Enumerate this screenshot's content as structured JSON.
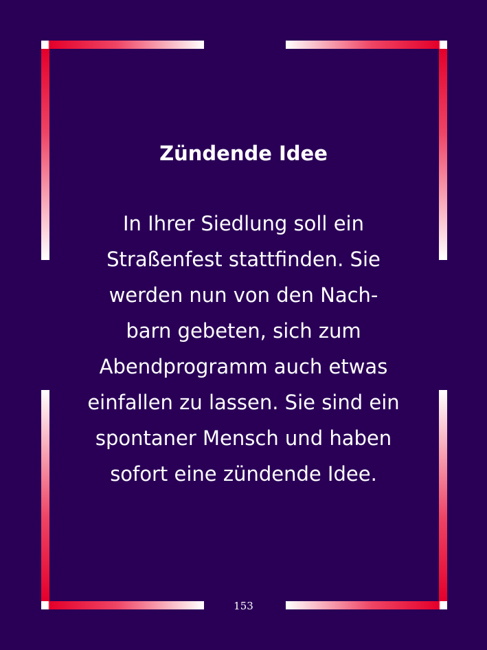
{
  "card": {
    "title": "Zündende Idee",
    "body_lines": [
      " In Ihrer Siedlung soll ein",
      "Straßenfest stattfinden. Sie",
      "werden nun von den Nach-",
      "barn gebeten, sich zum",
      "Abendprogramm auch etwas",
      "einfallen zu lassen. Sie sind ein",
      "spontaner Mensch und haben",
      "sofort eine zündende Idee."
    ],
    "page_number": "153"
  },
  "colors": {
    "background": "#2a0057",
    "frame_red": "#e4002a",
    "frame_white": "#ffffff",
    "text": "#ffffff"
  }
}
